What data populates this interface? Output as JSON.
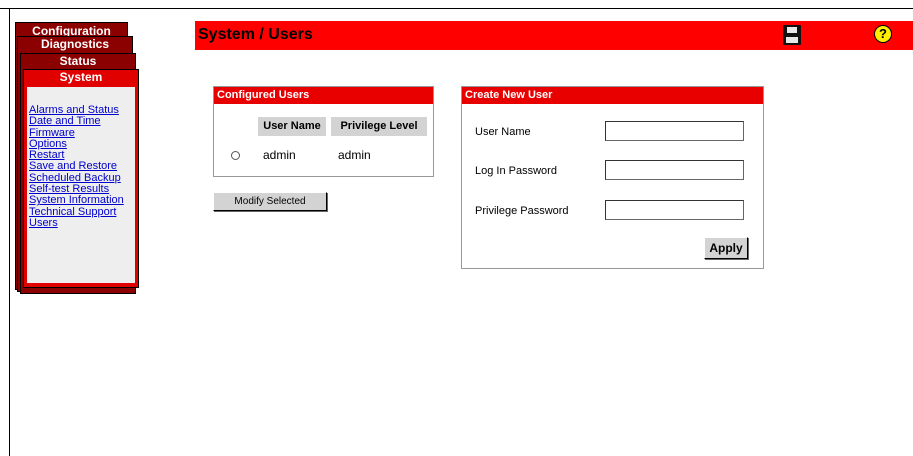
{
  "nav": {
    "tabs": [
      "Configuration",
      "Diagnostics",
      "Status",
      "System"
    ],
    "system_links": [
      "Alarms and Status",
      "Date and Time",
      "Firmware",
      "Options",
      "Restart",
      "Save and Restore",
      "Scheduled Backup",
      "Self-test Results",
      "System Information",
      "Technical Support",
      "Users"
    ]
  },
  "header": {
    "title": "System / Users",
    "save_icon": "floppy-disk-icon",
    "help_icon": "help-icon",
    "help_glyph": "?"
  },
  "configured_users": {
    "title": "Configured Users",
    "columns": [
      "User Name",
      "Privilege Level"
    ],
    "rows": [
      {
        "user_name": "admin",
        "privilege_level": "admin"
      }
    ],
    "modify_button": "Modify Selected"
  },
  "create_user": {
    "title": "Create New User",
    "fields": {
      "user_name": {
        "label": "User Name",
        "value": ""
      },
      "login_password": {
        "label": "Log In Password",
        "value": ""
      },
      "privilege_password": {
        "label": "Privilege Password",
        "value": ""
      }
    },
    "apply_button": "Apply"
  },
  "colors": {
    "brand_red": "#ff0000",
    "dark_red": "#8b0000",
    "link": "#0000cc"
  }
}
